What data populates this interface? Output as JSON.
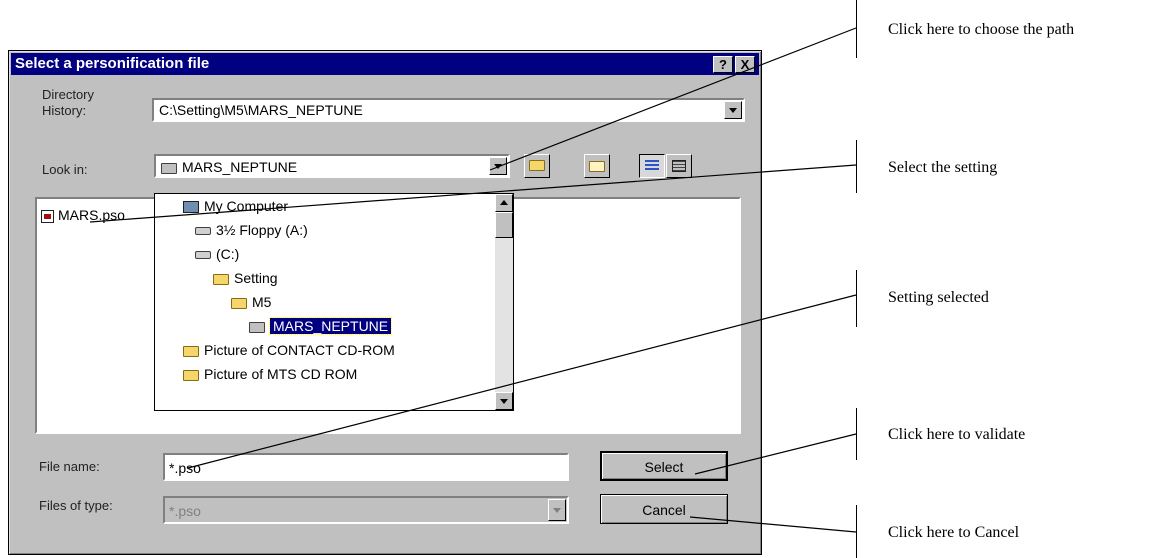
{
  "dialog": {
    "title": "Select a personification file",
    "help_button": "?",
    "close_button": "X",
    "directory_history_label": "Directory History:",
    "directory_history_value": "C:\\Setting\\M5\\MARS_NEPTUNE",
    "look_in_label": "Look in:",
    "look_in_value": "MARS_NEPTUNE",
    "file_list": [
      {
        "name": "MARS.pso",
        "icon": "pso-file-icon"
      }
    ],
    "dropdown_items": [
      {
        "label": "My Computer",
        "icon": "computer-icon",
        "indent": 0
      },
      {
        "label": "3½ Floppy (A:)",
        "icon": "floppy-drive-icon",
        "indent": 1
      },
      {
        "label": "(C:)",
        "icon": "hard-drive-icon",
        "indent": 1
      },
      {
        "label": "Setting",
        "icon": "folder-icon",
        "indent": 2
      },
      {
        "label": "M5",
        "icon": "folder-icon",
        "indent": 3
      },
      {
        "label": "MARS_NEPTUNE",
        "icon": "open-folder-icon",
        "indent": 4,
        "selected": true
      },
      {
        "label": "Picture of CONTACT CD-ROM",
        "icon": "folder-icon",
        "indent": 1
      },
      {
        "label": "Picture of MTS CD ROM",
        "icon": "folder-icon",
        "indent": 1
      }
    ],
    "file_name_label": "File name:",
    "file_name_value": "*.pso",
    "files_of_type_label": "Files of type:",
    "files_of_type_value": "*.pso",
    "select_button": "Select",
    "cancel_button": "Cancel"
  },
  "annotations": {
    "choose_path": "Click here to choose the path",
    "select_setting": "Select the setting",
    "setting_selected": "Setting selected",
    "validate": "Click here to validate",
    "cancel": "Click here to Cancel"
  }
}
